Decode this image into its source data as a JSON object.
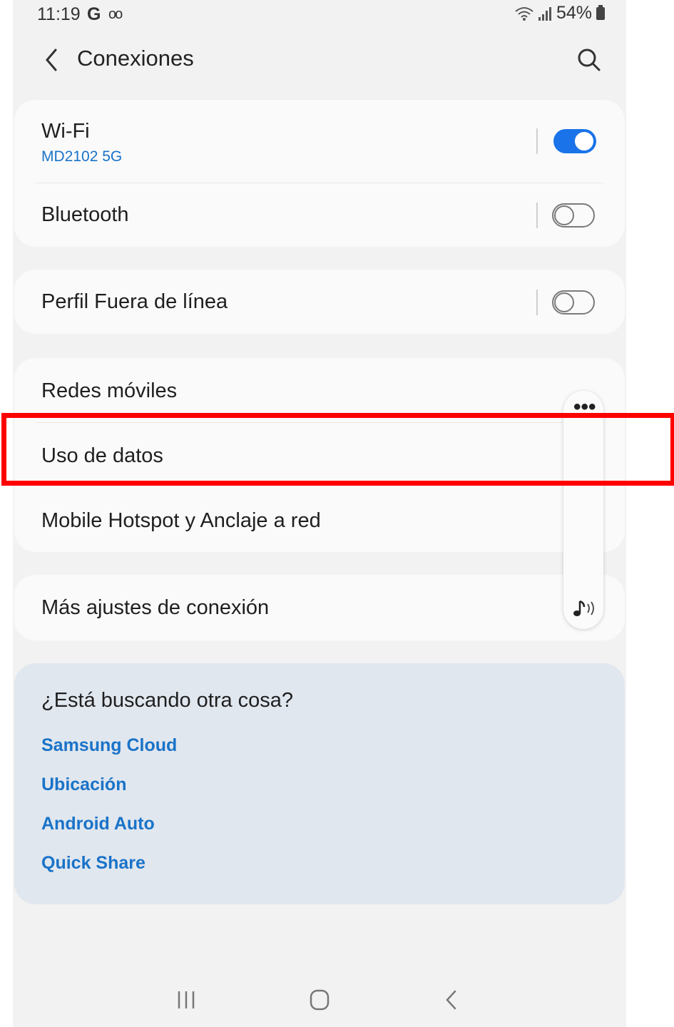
{
  "status_bar": {
    "time": "11:19",
    "carrier_glyph": "G",
    "voicemail_glyph": "oo",
    "battery": "54%"
  },
  "header": {
    "title": "Conexiones"
  },
  "groups": {
    "wifi": {
      "label": "Wi-Fi",
      "network": "MD2102 5G",
      "enabled": true
    },
    "bluetooth": {
      "label": "Bluetooth",
      "enabled": false
    },
    "offline": {
      "label": "Perfil Fuera de línea",
      "enabled": false
    },
    "mobile_networks": {
      "label": "Redes móviles"
    },
    "data_usage": {
      "label": "Uso de datos"
    },
    "hotspot": {
      "label": "Mobile Hotspot y Anclaje a red"
    },
    "more": {
      "label": "Más ajustes de conexión"
    }
  },
  "side_panel": {
    "menu_glyph": "•••",
    "icon": "sound-assistant-icon"
  },
  "suggestions": {
    "title": "¿Está buscando otra cosa?",
    "links": [
      "Samsung Cloud",
      "Ubicación",
      "Android Auto",
      "Quick Share"
    ]
  },
  "nav_bar": {
    "icons": [
      "recents-icon",
      "home-icon",
      "back-icon"
    ]
  },
  "colors": {
    "accent": "#1a73e8",
    "link": "#1a73c8",
    "highlight": "#ff0000",
    "background": "#f2f2f2",
    "suggest_bg": "#e1e7ef"
  }
}
